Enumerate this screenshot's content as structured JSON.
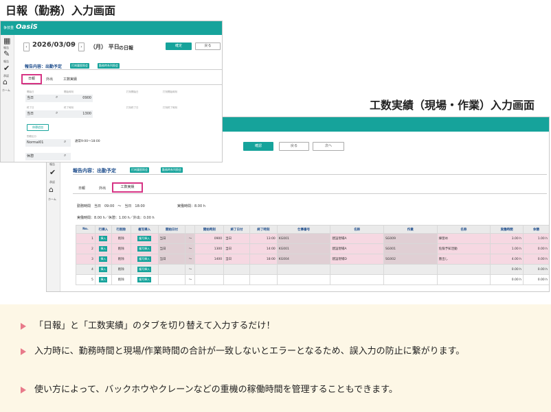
{
  "title_daily": "日報（勤務）入力画面",
  "title_work": "工数実績（現場・作業）入力画面",
  "app": {
    "logo_sub": "争技重",
    "logo": "OasiS"
  },
  "daily": {
    "date": "2026/03/09",
    "day": "（月） 平日",
    "suffix": "の日報",
    "btn_confirm": "確定",
    "btn_back": "戻る",
    "side": [
      {
        "label": "報告"
      },
      {
        "label": "報告"
      },
      {
        "label": "承認"
      },
      {
        "label": "ホーム"
      }
    ],
    "report_header": "報告内容：出勤予定",
    "chip1": "打刻履歴照会",
    "chip2": "勤務時系列照会",
    "tabs": [
      "日報",
      "外出",
      "工数実績"
    ],
    "f_start_label": "開始日",
    "f_start": "当日",
    "f_start_time_label": "開始時刻",
    "f_start_time": "0900",
    "f_end_label": "終了日",
    "f_end": "当日",
    "f_end_time_label": "終了時刻",
    "f_end_time": "1300",
    "f_stamp_start": "打刻開始日",
    "f_stamp_start_time": "打刻開始時刻",
    "f_stamp_end": "打刻終了日",
    "f_stamp_end_time": "打刻終了時刻",
    "btn_break": "休憩追加",
    "f_kbn_label": "勤務区分",
    "f_kbn": "Normal01",
    "f_kbn_note": "通常9:00～18:00",
    "f_break": "休憩"
  },
  "work": {
    "btn_confirm": "確認",
    "btn_back": "戻る",
    "btn_next": "次へ",
    "side": [
      {
        "label": "報告"
      },
      {
        "label": "承認"
      },
      {
        "label": "ホーム"
      }
    ],
    "report_header": "報告内容：出勤予定",
    "chip1": "打刻履歴照会",
    "chip2": "勤務時系列照会",
    "tabs": [
      "日報",
      "外出",
      "工数実績"
    ],
    "summary1": "勤務時間　当日　09:00　～　当日　18:00",
    "summary1b": "実働時間：8.00 h",
    "summary2": "実働時間：8.00 h／休憩：1.00 h／外出：0.00 h",
    "columns": [
      "No.",
      "行挿入",
      "行削除",
      "複写挿入",
      "開始日付",
      "",
      "開始時刻",
      "終了日付",
      "終了時刻",
      "仕事番号",
      "名称",
      "作業",
      "名称",
      "実働時間",
      "休憩"
    ],
    "rows": [
      {
        "no": "1",
        "ins": "挿入",
        "del": "削除",
        "copy": "複写挿入",
        "sdate": "当日",
        "stime": "0900",
        "edate": "当日",
        "etime": "13:00",
        "job": "KG001",
        "jname": "建設現場A",
        "task": "SG009",
        "tname": "練習め",
        "hours": "3.00 h",
        "brk": "1.00 h",
        "style": "pk"
      },
      {
        "no": "2",
        "ins": "挿入",
        "del": "削除",
        "copy": "複写挿入",
        "sdate": "当日",
        "stime": "1300",
        "edate": "当日",
        "etime": "14:00",
        "job": "KG001",
        "jname": "建設現場A",
        "task": "SG001",
        "tname": "危険予知活動",
        "hours": "1.00 h",
        "brk": "0.00 h",
        "style": "pk"
      },
      {
        "no": "3",
        "ins": "挿入",
        "del": "削除",
        "copy": "複写挿入",
        "sdate": "当日",
        "stime": "1400",
        "edate": "当日",
        "etime": "18:00",
        "job": "KG004",
        "jname": "建設現場D",
        "task": "SG002",
        "tname": "墨出し",
        "hours": "4.00 h",
        "brk": "0.00 h",
        "style": "pk"
      },
      {
        "no": "4",
        "ins": "挿入",
        "del": "削除",
        "copy": "複写挿入",
        "sdate": "",
        "stime": "",
        "edate": "",
        "etime": "",
        "job": "",
        "jname": "",
        "task": "",
        "tname": "",
        "hours": "0.00 h",
        "brk": "0.00 h",
        "style": "gy"
      },
      {
        "no": "5",
        "ins": "挿入",
        "del": "削除",
        "copy": "複写挿入",
        "sdate": "",
        "stime": "",
        "edate": "",
        "etime": "",
        "job": "",
        "jname": "",
        "task": "",
        "tname": "",
        "hours": "0.00 h",
        "brk": "0.00 h",
        "style": "wt"
      }
    ]
  },
  "bullets": [
    "「日報」と「工数実績」のタブを切り替えて入力するだけ！",
    "入力時に、勤務時間と現場/作業時間の合計が一致しないとエラーとなるため、誤入力の防止に繋がります。",
    "使い方によって、バックホウやクレーンなどの重機の稼働時間を管理することもできます。"
  ],
  "colors": {
    "accent": "#16a39b",
    "highlight": "#d63384",
    "pink_row": "#f6d8e2",
    "info_bg": "#fdf7e6"
  }
}
